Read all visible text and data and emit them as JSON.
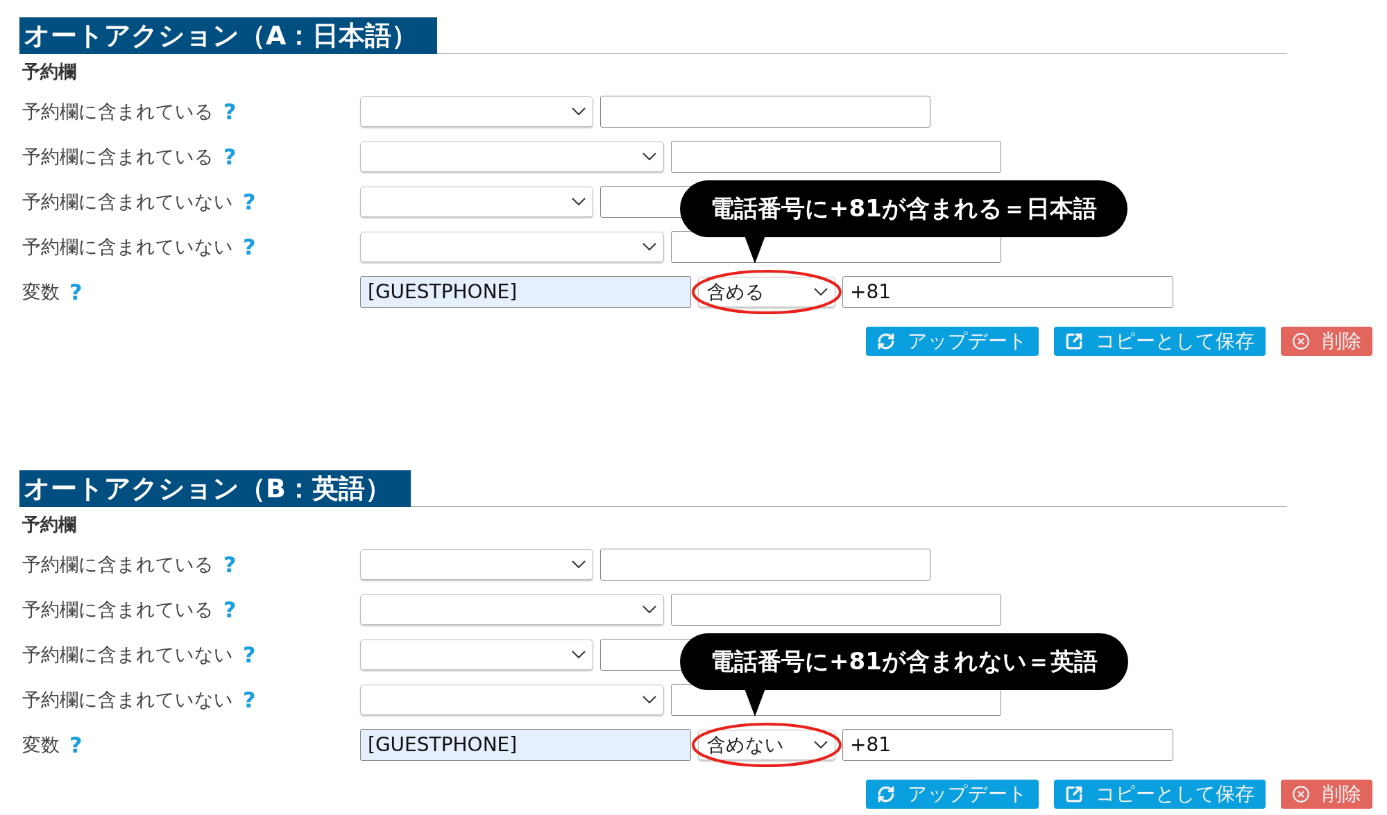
{
  "sections": [
    {
      "title": "オートアクション（A：日本語）",
      "group_label": "予約欄",
      "rows": [
        {
          "label": "予約欄に含まれている",
          "help": "?"
        },
        {
          "label": "予約欄に含まれている",
          "help": "?"
        },
        {
          "label": "予約欄に含まれていない",
          "help": "?"
        },
        {
          "label": "予約欄に含まれていない",
          "help": "?"
        }
      ],
      "variable": {
        "label": "変数",
        "help": "?",
        "field_value": "[GUESTPHONE]",
        "operator": "含める",
        "value": "+81"
      },
      "callout": "電話番号に+81が含まれる＝日本語",
      "buttons": [
        {
          "kind": "update",
          "label": "アップデート"
        },
        {
          "kind": "copy",
          "label": "コピーとして保存"
        },
        {
          "kind": "delete",
          "label": "削除"
        }
      ]
    },
    {
      "title": "オートアクション（B：英語）",
      "group_label": "予約欄",
      "rows": [
        {
          "label": "予約欄に含まれている",
          "help": "?"
        },
        {
          "label": "予約欄に含まれている",
          "help": "?"
        },
        {
          "label": "予約欄に含まれていない",
          "help": "?"
        },
        {
          "label": "予約欄に含まれていない",
          "help": "?"
        }
      ],
      "variable": {
        "label": "変数",
        "help": "?",
        "field_value": "[GUESTPHONE]",
        "operator": "含めない",
        "value": "+81"
      },
      "callout": "電話番号に+81が含まれない＝英語",
      "buttons": [
        {
          "kind": "update",
          "label": "アップデート"
        },
        {
          "kind": "copy",
          "label": "コピーとして保存"
        },
        {
          "kind": "delete",
          "label": "削除"
        }
      ]
    }
  ]
}
